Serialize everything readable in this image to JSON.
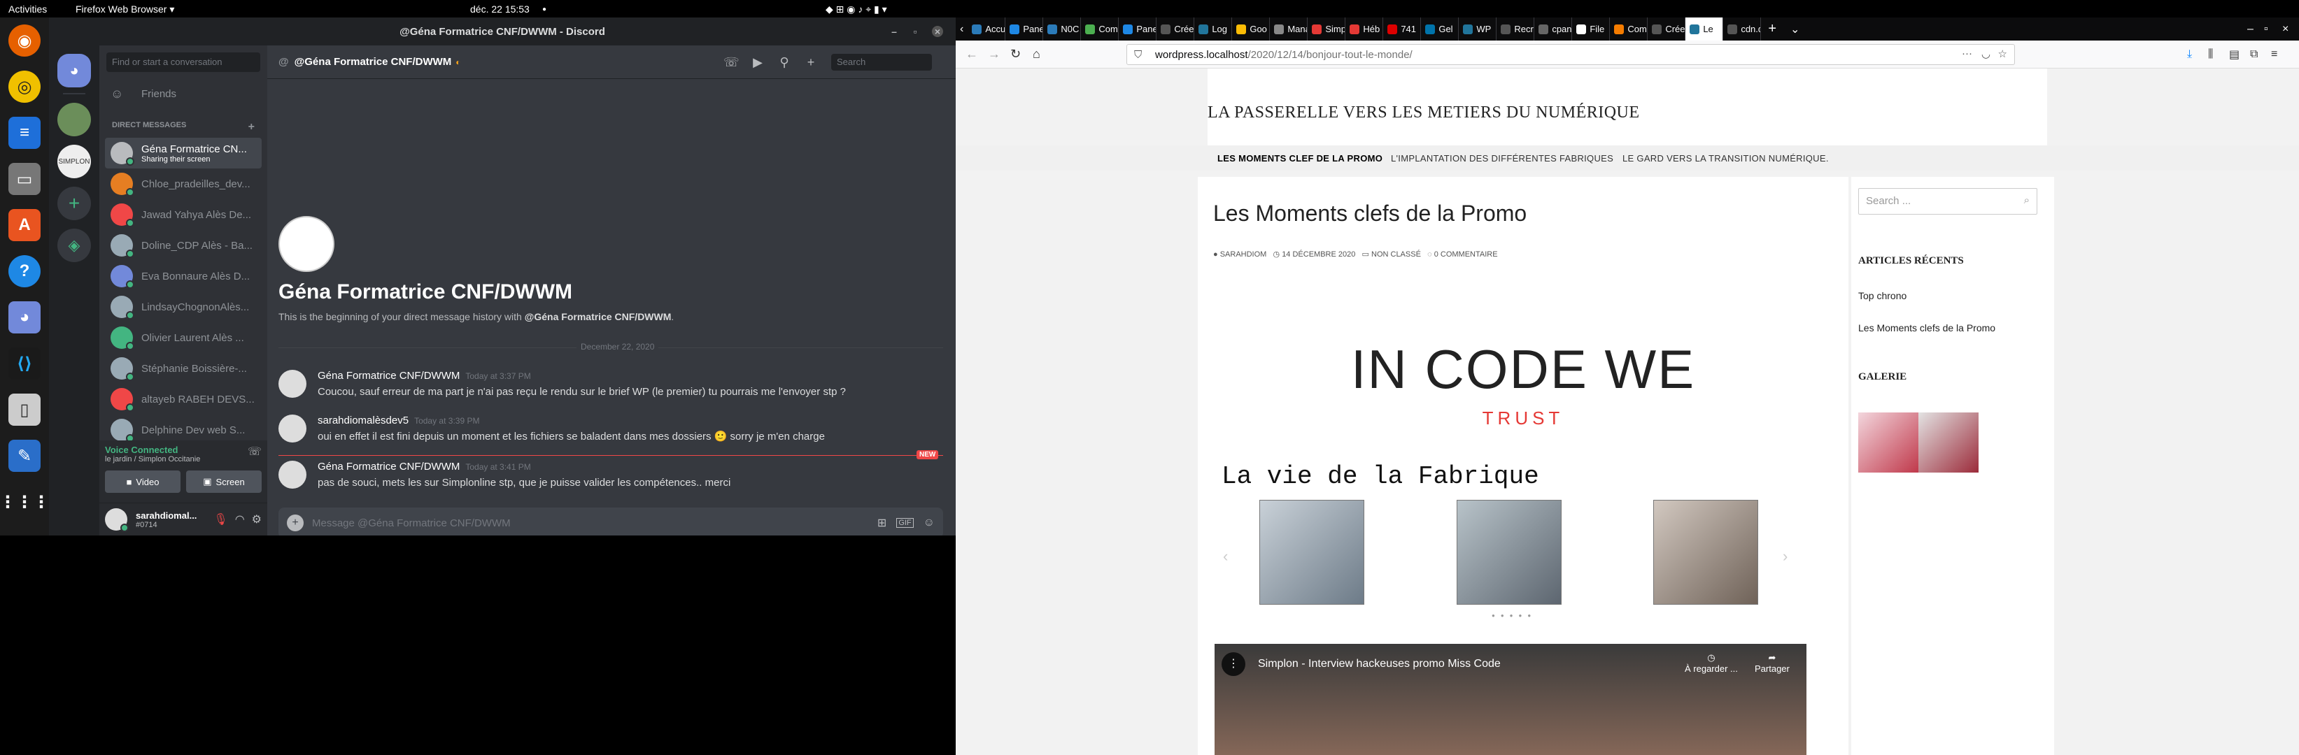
{
  "topbar": {
    "activities": "Activities",
    "app_menu": "Firefox Web Browser ▾",
    "clock": "déc. 22  15:53"
  },
  "discord": {
    "window_title": "@Géna Formatrice CNF/DWWM - Discord",
    "search_placeholder": "Find or start a conversation",
    "friends_label": "Friends",
    "dm_header": "DIRECT MESSAGES",
    "dms": [
      {
        "name": "Géna Formatrice CN...",
        "sub": "Sharing their screen",
        "color": "#b9bbbe"
      },
      {
        "name": "Chloe_pradeilles_dev...",
        "sub": "",
        "color": "#e67e22"
      },
      {
        "name": "Jawad Yahya Alès De...",
        "sub": "",
        "color": "#f04747"
      },
      {
        "name": "Doline_CDP Alès - Ba...",
        "sub": "",
        "color": "#99aab5"
      },
      {
        "name": "Eva Bonnaure Alès D...",
        "sub": "",
        "color": "#7289da"
      },
      {
        "name": "LindsayChognonAlès...",
        "sub": "",
        "color": "#99aab5"
      },
      {
        "name": "Olivier Laurent Alès ...",
        "sub": "",
        "color": "#43b581"
      },
      {
        "name": "Stéphanie Boissière-...",
        "sub": "",
        "color": "#99aab5"
      },
      {
        "name": "altayeb RABEH DEVS...",
        "sub": "",
        "color": "#f04747"
      },
      {
        "name": "Delphine Dev web S...",
        "sub": "",
        "color": "#99aab5"
      }
    ],
    "voice": {
      "status": "Voice Connected",
      "channel": "le jardin / Simplon Occitanie",
      "video": "Video",
      "screen": "Screen"
    },
    "user": {
      "name": "sarahdiomal...",
      "tag": "#0714"
    },
    "chat_header": "@Géna Formatrice CNF/DWWM",
    "header_search": "Search",
    "intro_title": "Géna Formatrice CNF/DWWM",
    "intro_text_prefix": "This is the beginning of your direct message history with ",
    "intro_text_user": "@Géna Formatrice CNF/DWWM",
    "intro_text_suffix": ".",
    "date_divider": "December 22, 2020",
    "messages": [
      {
        "author": "Géna Formatrice CNF/DWWM",
        "time": "Today at 3:37 PM",
        "text": "Coucou, sauf erreur de ma part je n'ai pas reçu le rendu sur le brief WP (le premier) tu pourrais me l'envoyer stp ?"
      },
      {
        "author": "sarahdiomalèsdev5",
        "time": "Today at 3:39 PM",
        "text": "oui en effet il est fini depuis un moment et les fichiers se baladent dans mes dossiers 🙂 sorry je m'en charge"
      },
      {
        "author": "Géna Formatrice CNF/DWWM",
        "time": "Today at 3:41 PM",
        "text": "pas de souci, mets les sur Simplonline stp, que je puisse valider les compétences.. merci"
      }
    ],
    "new_badge": "NEW",
    "message_placeholder": "Message @Géna Formatrice CNF/DWWM"
  },
  "firefox": {
    "tabs": [
      "Accu",
      "Pane",
      "N0C",
      "Com",
      "Pane",
      "Créer un",
      "Log",
      "Goo",
      "Manage",
      "Simp",
      "Héb",
      "741",
      "Gel",
      "WP",
      "Recruta",
      "cpanel.l",
      "File",
      "Com",
      "Crée",
      "Le",
      "cdn.disc"
    ],
    "url_host": "wordpress.localhost",
    "url_path": "/2020/12/14/bonjour-tout-le-monde/"
  },
  "site": {
    "site_title": "LA PASSERELLE VERS LES METIERS DU NUMÉRIQUE",
    "nav": [
      "LES MOMENTS CLEF DE LA PROMO",
      "L'IMPLANTATION DES DIFFÉRENTES FABRIQUES",
      "LE GARD VERS LA TRANSITION NUMÉRIQUE."
    ],
    "post_title": "Les Moments clefs de la Promo",
    "meta_author": "SARAHDIOM",
    "meta_date": "14 DÉCEMBRE 2020",
    "meta_category": "NON CLASSÉ",
    "meta_comments": "0 COMMENTAIRE",
    "banner_main": "IN CODE WE",
    "banner_sub": "TRUST",
    "section_title": "La vie de la Fabrique",
    "video_title": "Simplon - Interview hackeuses promo Miss Code",
    "video_watch_later": "À regarder ...",
    "video_share": "Partager",
    "search_placeholder": "Search ...",
    "recent_heading": "ARTICLES RÉCENTS",
    "recent_posts": [
      "Top chrono",
      "Les Moments clefs de la Promo"
    ],
    "gallery_heading": "GALERIE"
  }
}
